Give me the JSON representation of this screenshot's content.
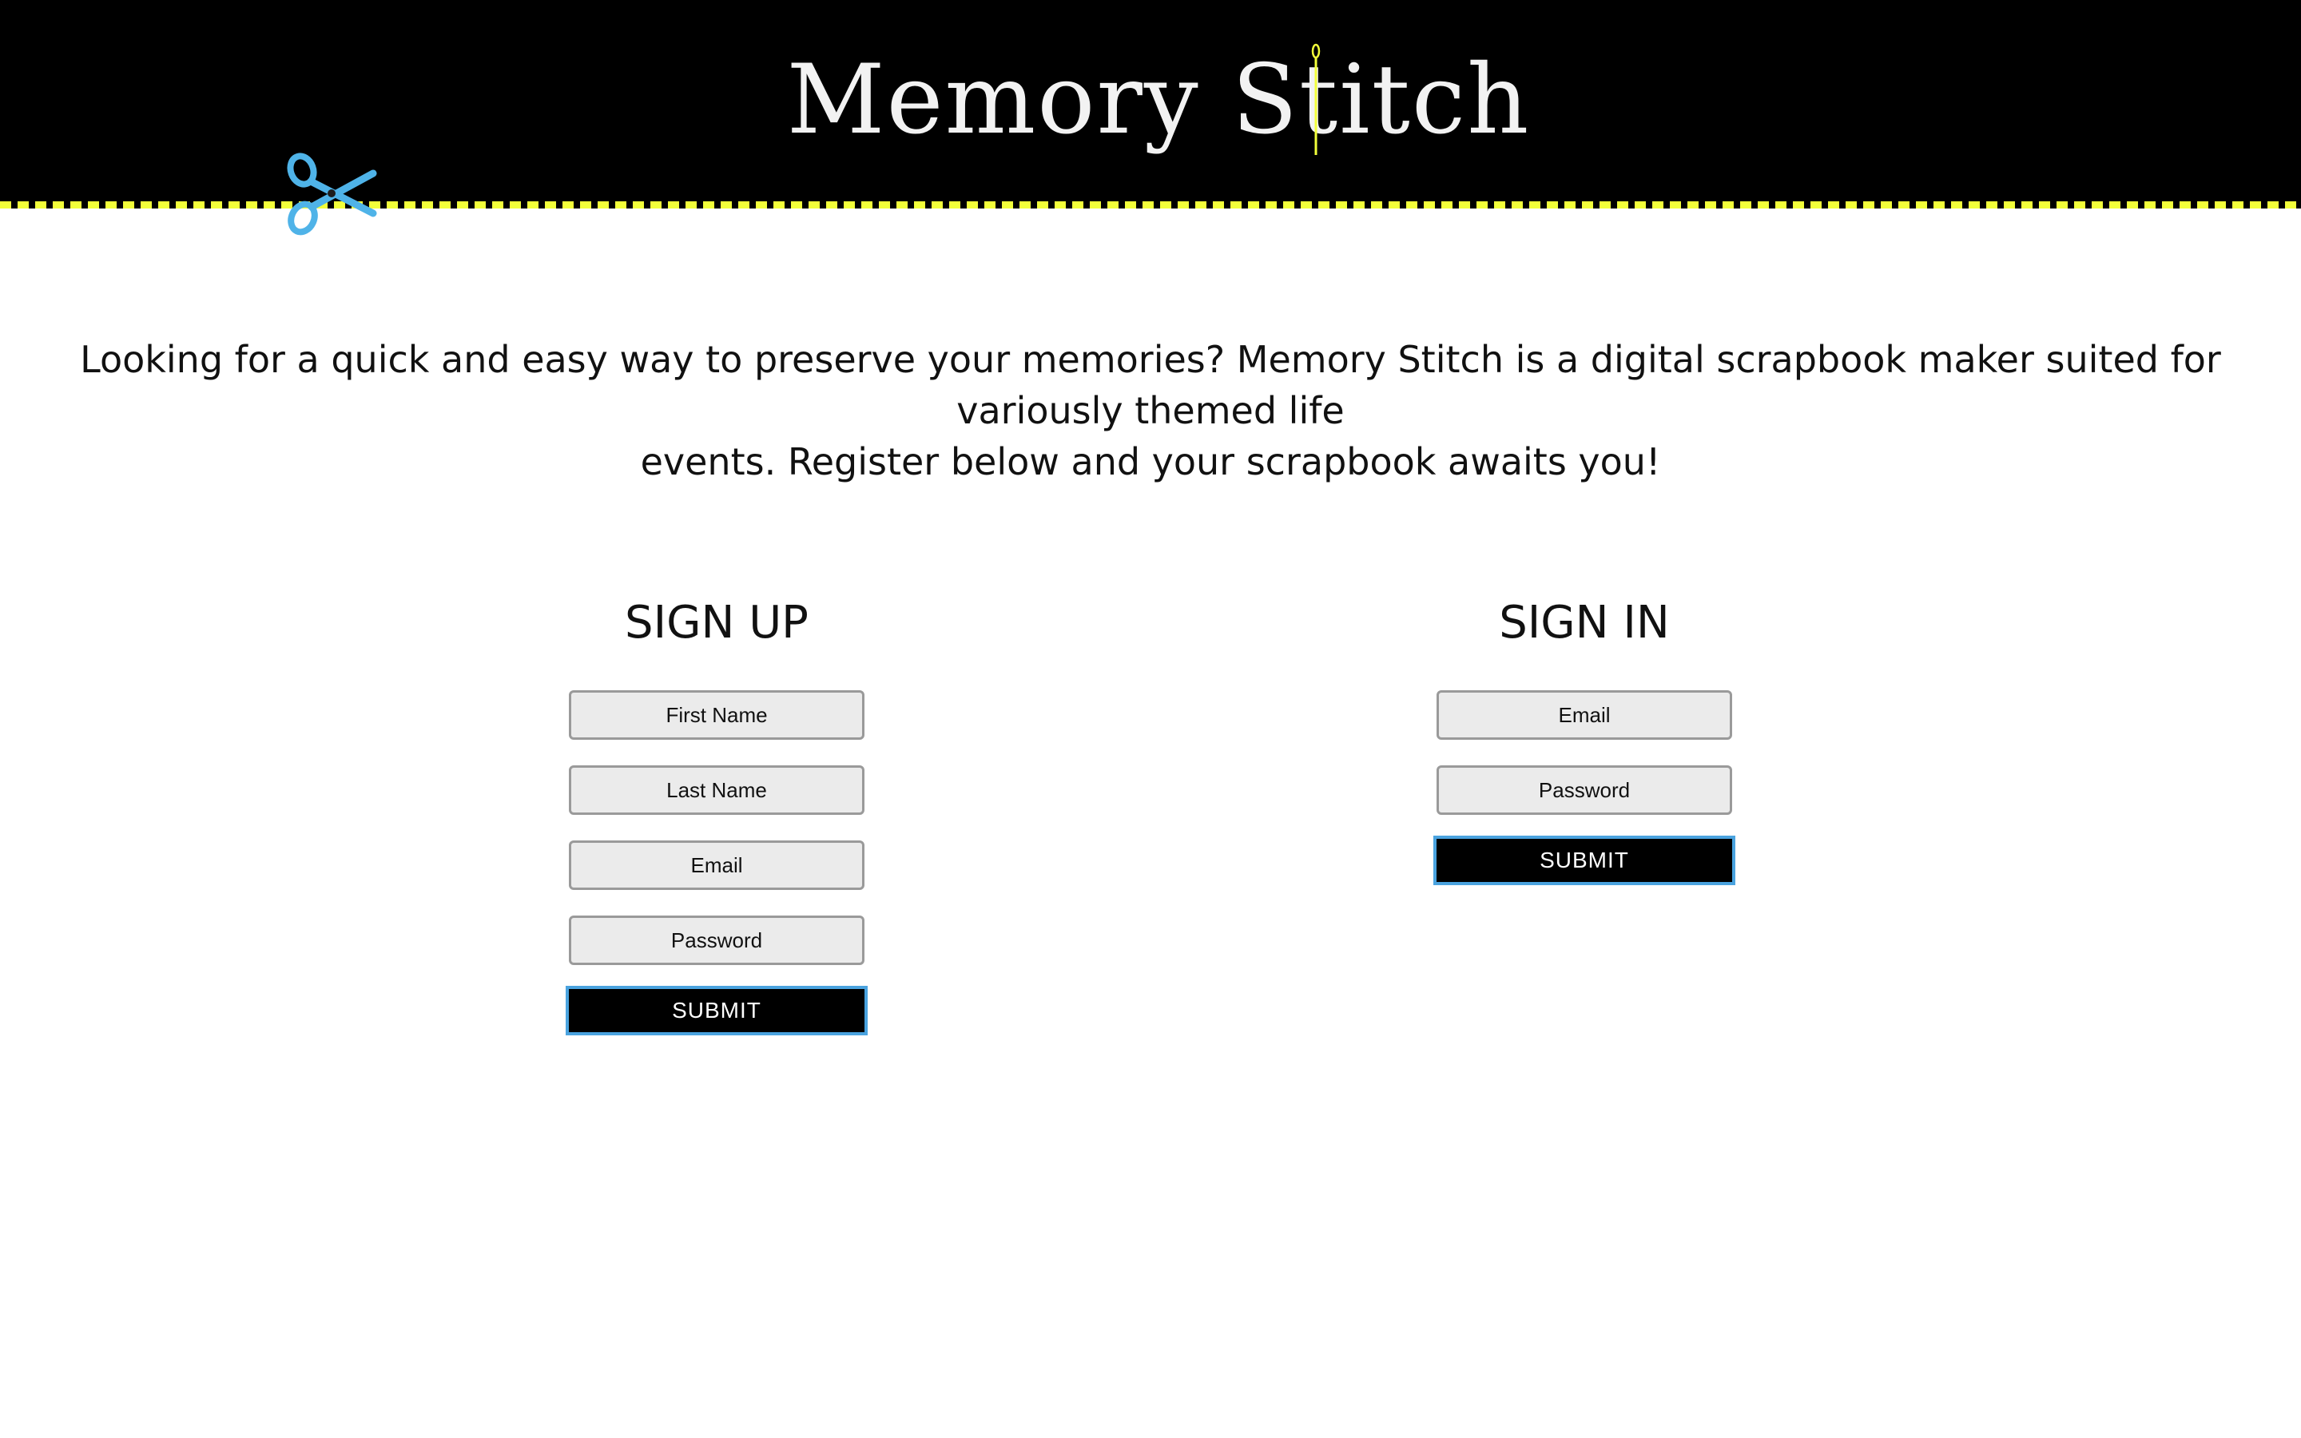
{
  "header": {
    "logo_text": "Memory Stitch",
    "stitch_color": "#f2ff3a",
    "scissors_color": "#4fb3e8",
    "needle_color": "#f2ff3a",
    "icons": [
      "scissors-icon",
      "needle-icon"
    ]
  },
  "intro": {
    "line1": "Looking for a quick and easy way to preserve your memories? Memory Stitch is a digital scrapbook maker suited for variously themed life",
    "line2": "events. Register below and your scrapbook awaits you!"
  },
  "signup": {
    "title": "SIGN UP",
    "first_name_placeholder": "First Name",
    "last_name_placeholder": "Last Name",
    "email_placeholder": "Email",
    "password_placeholder": "Password",
    "submit_label": "SUBMIT"
  },
  "signin": {
    "title": "SIGN IN",
    "email_placeholder": "Email",
    "password_placeholder": "Password",
    "submit_label": "SUBMIT"
  },
  "colors": {
    "header_bg": "#000000",
    "button_bg": "#000000",
    "button_border": "#4aa3df",
    "input_bg": "#ebebeb"
  }
}
